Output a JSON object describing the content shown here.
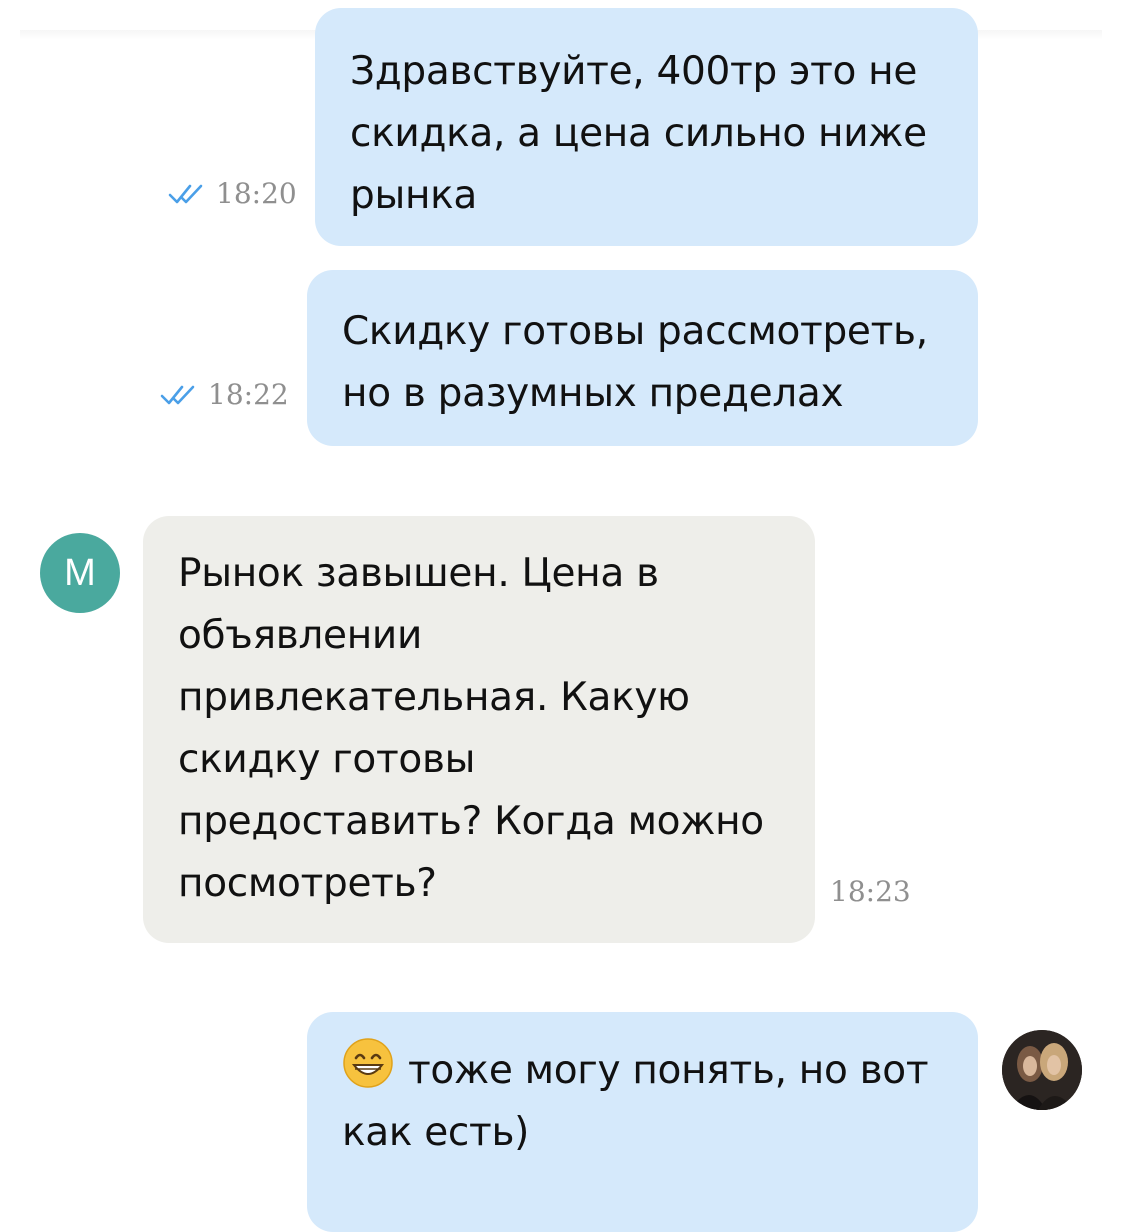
{
  "messages": [
    {
      "text": "Здравствуйте, 400тр это не\nскидка, а цена сильно ниже\nрынка",
      "time": "18:20",
      "status": "read"
    },
    {
      "text": "Скидку готовы рассмотреть,\nно в разумных пределах",
      "time": "18:22",
      "status": "read"
    },
    {
      "sender_initial": "М",
      "text": "Рынок завышен. Цена в\nобъявлении\nпривлекательная. Какую\nскидку готовы\nпредоставить? Когда можно\nпосмотреть?",
      "time": "18:23"
    },
    {
      "emoji": "grinning-face-emoji",
      "text": "тоже могу понять, но вот\nкак есть)"
    }
  ],
  "colors": {
    "outgoing_bubble": "#d5e9fb",
    "incoming_bubble": "#eeeeea",
    "read_check": "#4a9fe8",
    "sender_avatar": "#4aa99e",
    "timestamp": "#8f8f8f"
  }
}
